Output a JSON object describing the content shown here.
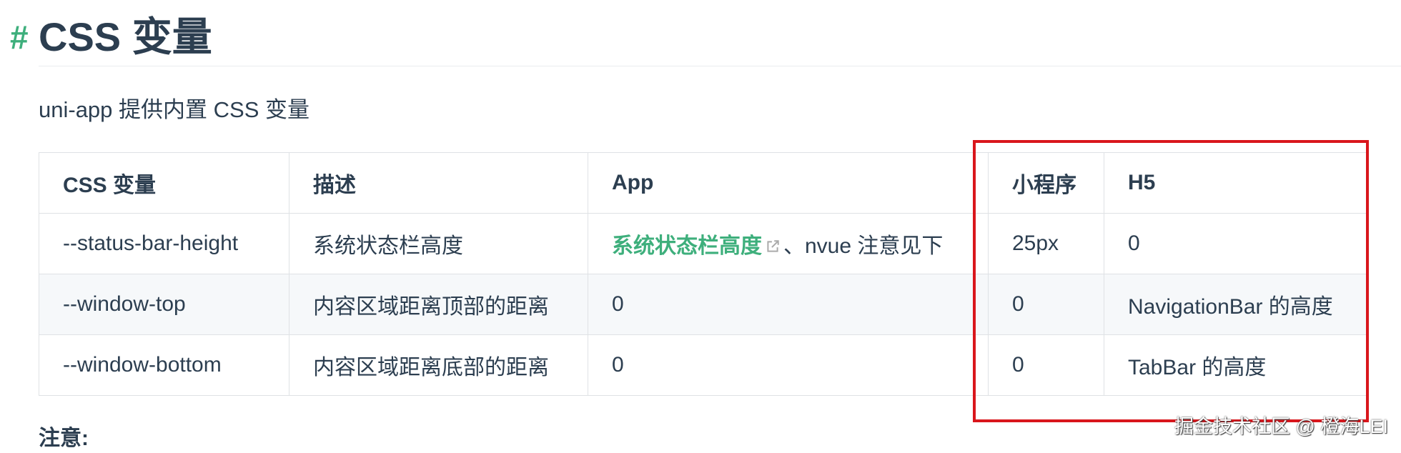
{
  "heading": {
    "anchor": "#",
    "title": "CSS 变量"
  },
  "intro": "uni-app 提供内置 CSS 变量",
  "table": {
    "headers": [
      "CSS 变量",
      "描述",
      "App",
      "小程序",
      "H5"
    ],
    "rows": [
      {
        "var": "--status-bar-height",
        "desc": "系统状态栏高度",
        "app_link": "系统状态栏高度",
        "app_suffix": "、nvue 注意见下",
        "mp": "25px",
        "h5": "0"
      },
      {
        "var": "--window-top",
        "desc": "内容区域距离顶部的距离",
        "app": "0",
        "mp": "0",
        "h5": "NavigationBar 的高度"
      },
      {
        "var": "--window-bottom",
        "desc": "内容区域距离底部的距离",
        "app": "0",
        "mp": "0",
        "h5": "TabBar 的高度"
      }
    ]
  },
  "note": "注意:",
  "watermark": "掘金技术社区 @ 橙海LEI",
  "colors": {
    "accent": "#3eaf7c",
    "text": "#2c3e50",
    "highlight_box": "#d9161c"
  },
  "icons": {
    "external_link": "external-link-icon"
  }
}
